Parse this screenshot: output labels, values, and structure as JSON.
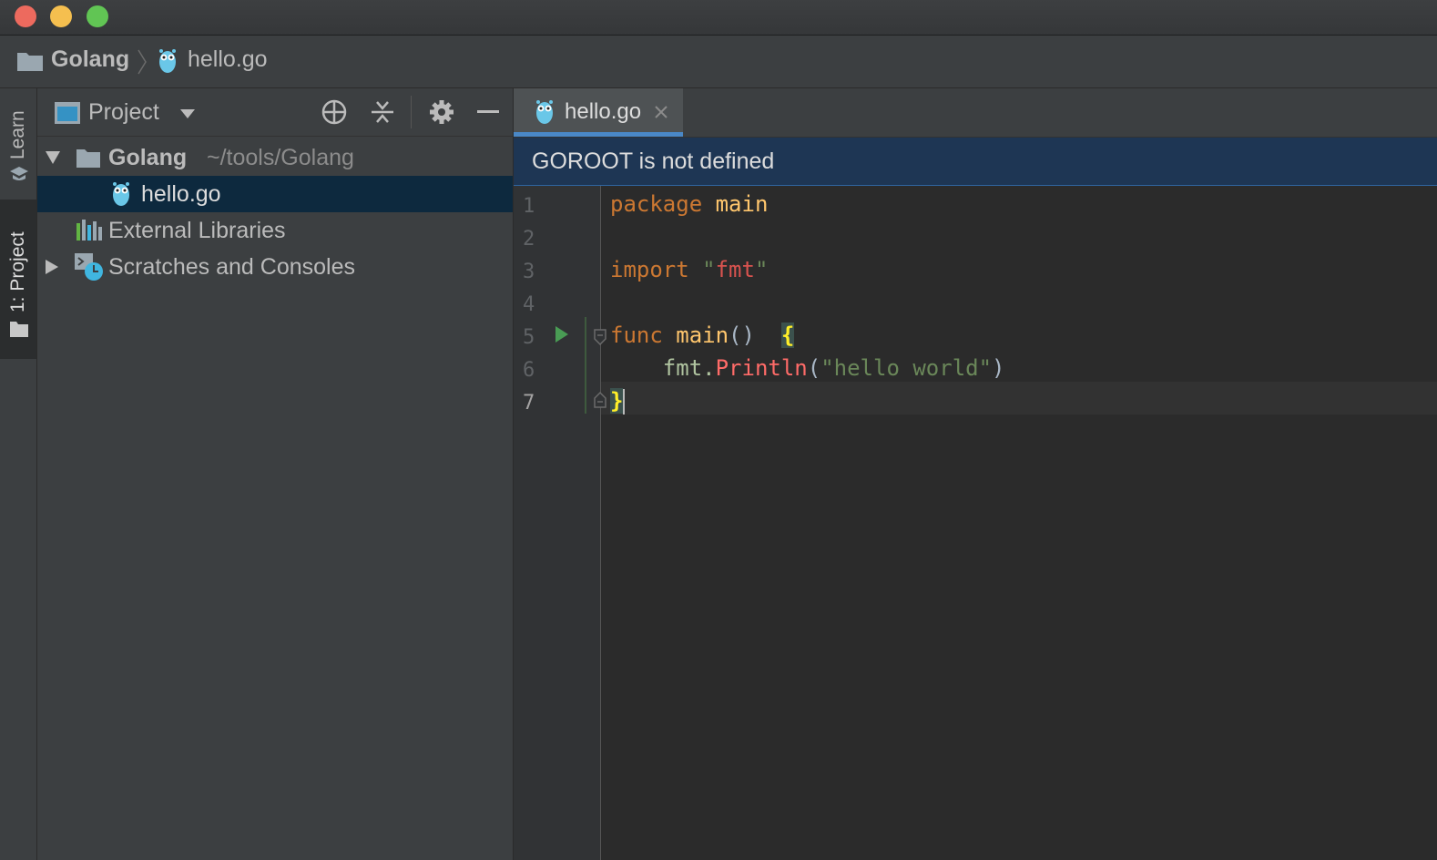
{
  "breadcrumb": {
    "project": "Golang",
    "file": "hello.go"
  },
  "stripe": {
    "learn_tab": "Learn",
    "project_tab": "1: Project"
  },
  "panel": {
    "view_label": "Project",
    "tree": {
      "root_name": "Golang",
      "root_path": "~/tools/Golang",
      "file": "hello.go",
      "external": "External Libraries",
      "scratches": "Scratches and Consoles"
    }
  },
  "editor": {
    "tab_label": "hello.go",
    "banner": "GOROOT is not defined",
    "line_numbers": [
      "1",
      "2",
      "3",
      "4",
      "5",
      "6",
      "7"
    ],
    "code": {
      "l1_kw": "package",
      "l1_name": " main",
      "l3_kw": "import",
      "l3_str_open": " \"",
      "l3_str": "fmt",
      "l3_str_close": "\"",
      "l5_kw": "func",
      "l5_name": " main",
      "l5_parens": "()  ",
      "l5_brace": "{",
      "l6_pkg": "    fmt.",
      "l6_call": "Println",
      "l6_open": "(",
      "l6_str": "\"hello world\"",
      "l6_close": ")",
      "l7_brace": "}"
    }
  },
  "colors": {
    "accent": "#4a88c7",
    "selection": "#0d293e",
    "banner": "#1e3654",
    "close_light": "#ed6a5e",
    "minimize_light": "#f5bf4f",
    "zoom_light": "#61c554"
  }
}
